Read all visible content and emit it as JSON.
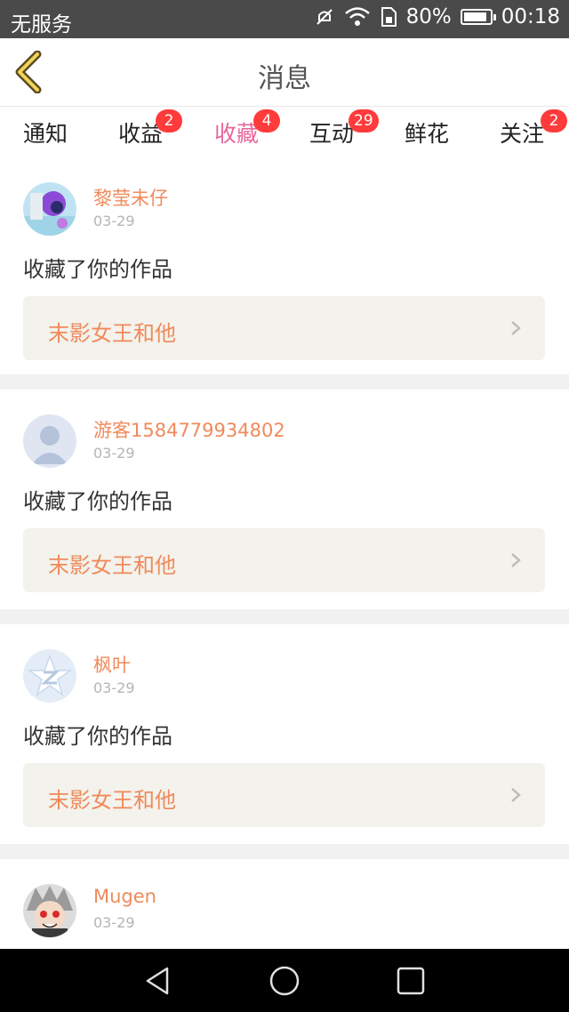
{
  "status_bar": {
    "carrier": "无服务",
    "battery": "80%",
    "time": "00:18",
    "icons": [
      "mute-icon",
      "wifi-icon",
      "sim-icon",
      "battery-icon"
    ]
  },
  "header": {
    "title": "消息"
  },
  "tabs": [
    {
      "label": "通知",
      "badge": ""
    },
    {
      "label": "收益",
      "badge": "2"
    },
    {
      "label": "收藏",
      "badge": "4",
      "active": true
    },
    {
      "label": "互动",
      "badge": "29"
    },
    {
      "label": "鲜花",
      "badge": ""
    },
    {
      "label": "关注",
      "badge": "2"
    }
  ],
  "messages": [
    {
      "user": "黎莹未仔",
      "date": "03-29",
      "text": "收藏了你的作品",
      "work": "末影女王和他"
    },
    {
      "user": "游客1584779934802",
      "date": "03-29",
      "text": "收藏了你的作品",
      "work": "末影女王和他"
    },
    {
      "user": "枫叶",
      "date": "03-29",
      "text": "收藏了你的作品",
      "work": "末影女王和他"
    },
    {
      "user": "Mugen",
      "date": "03-29"
    }
  ],
  "colors": {
    "accent": "#e8679b",
    "username": "#f08a5b",
    "badge": "#ff3b3b"
  }
}
